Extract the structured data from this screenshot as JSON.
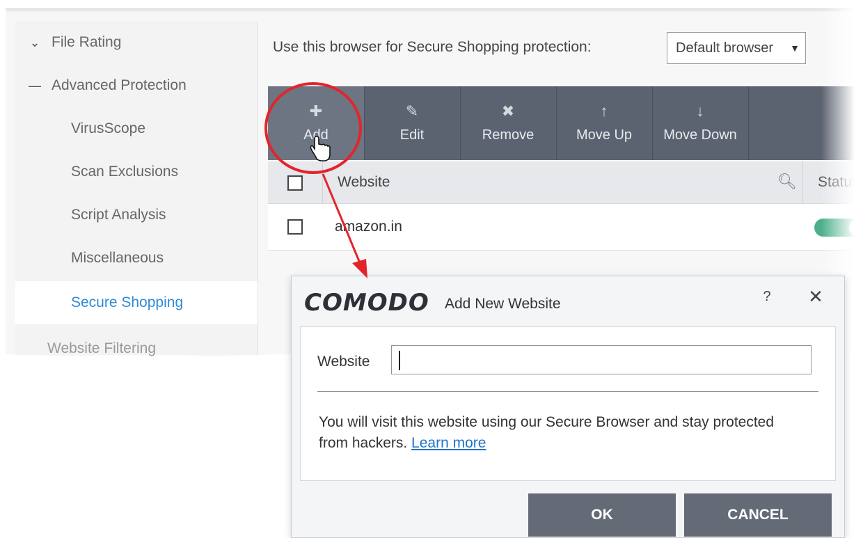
{
  "sidebar": {
    "items": [
      {
        "label": "File Rating",
        "icon": "chevron-down-icon",
        "level": 0
      },
      {
        "label": "Advanced Protection",
        "icon": "minus-icon",
        "level": 0
      },
      {
        "label": "VirusScope",
        "level": 1
      },
      {
        "label": "Scan Exclusions",
        "level": 1
      },
      {
        "label": "Script Analysis",
        "level": 1
      },
      {
        "label": "Miscellaneous",
        "level": 1
      },
      {
        "label": "Secure Shopping",
        "level": 1,
        "active": true
      },
      {
        "label": "Website Filtering",
        "level": 0
      }
    ]
  },
  "browser": {
    "label": "Use this browser for Secure Shopping protection:",
    "selected": "Default browser"
  },
  "toolbar": {
    "add": "Add",
    "edit": "Edit",
    "remove": "Remove",
    "move_up": "Move Up",
    "move_down": "Move Down"
  },
  "table": {
    "columns": {
      "website": "Website",
      "status": "Status"
    },
    "rows": [
      {
        "website": "amazon.in",
        "status_on": true
      }
    ]
  },
  "dialog": {
    "logo": "COMODO",
    "title": "Add New Website",
    "help": "?",
    "close": "✕",
    "field_label": "Website",
    "field_value": "",
    "info_text": "You will visit this website using our Secure Browser and stay protected from hackers.",
    "learn_more": "Learn more",
    "ok_label": "OK",
    "cancel_label": "CANCEL"
  },
  "colors": {
    "accent_blue": "#2f8ad8",
    "toolbar": "#5c6370",
    "highlight_red": "#e3242b",
    "toggle_green": "#4db08a"
  }
}
